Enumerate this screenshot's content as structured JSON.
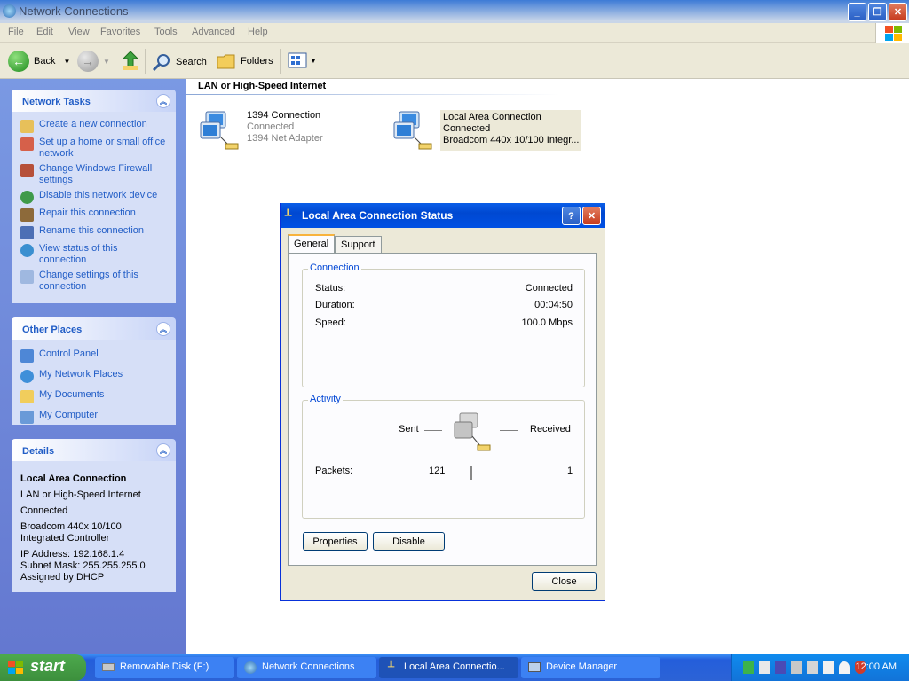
{
  "window": {
    "title": "Network Connections"
  },
  "menu": [
    "File",
    "Edit",
    "View",
    "Favorites",
    "Tools",
    "Advanced",
    "Help"
  ],
  "toolbar": {
    "back": "Back",
    "search": "Search",
    "folders": "Folders"
  },
  "tasks": {
    "title": "Network Tasks",
    "items": [
      "Create a new connection",
      "Set up a home or small office network",
      "Change Windows Firewall settings",
      "Disable this network device",
      "Repair this connection",
      "Rename this connection",
      "View status of this connection",
      "Change settings of this connection"
    ]
  },
  "places": {
    "title": "Other Places",
    "items": [
      "Control Panel",
      "My Network Places",
      "My Documents",
      "My Computer"
    ]
  },
  "details": {
    "title": "Details",
    "name": "Local Area Connection",
    "type": "LAN or High-Speed Internet",
    "status": "Connected",
    "adapter": "Broadcom 440x 10/100 Integrated Controller",
    "ip": "IP Address: 192.168.1.4",
    "mask": "Subnet Mask: 255.255.255.0",
    "dhcp": "Assigned by DHCP"
  },
  "content": {
    "header": "LAN or High-Speed Internet",
    "connections": [
      {
        "name": "1394 Connection",
        "status": "Connected",
        "device": "1394 Net Adapter"
      },
      {
        "name": "Local Area Connection",
        "status": "Connected",
        "device": "Broadcom 440x 10/100 Integr..."
      }
    ]
  },
  "dialog": {
    "title": "Local Area Connection Status",
    "tabs": [
      "General",
      "Support"
    ],
    "connection": {
      "label": "Connection",
      "status_label": "Status:",
      "status": "Connected",
      "duration_label": "Duration:",
      "duration": "00:04:50",
      "speed_label": "Speed:",
      "speed": "100.0 Mbps"
    },
    "activity": {
      "label": "Activity",
      "sent": "Sent",
      "received": "Received",
      "packets_label": "Packets:",
      "packets_sent": "121",
      "packets_received": "1"
    },
    "properties": "Properties",
    "disable": "Disable",
    "close": "Close"
  },
  "taskbar": {
    "start": "start",
    "buttons": [
      "Removable Disk (F:)",
      "Network Connections",
      "Local Area Connectio...",
      "Device Manager"
    ],
    "clock": "12:00 AM"
  }
}
